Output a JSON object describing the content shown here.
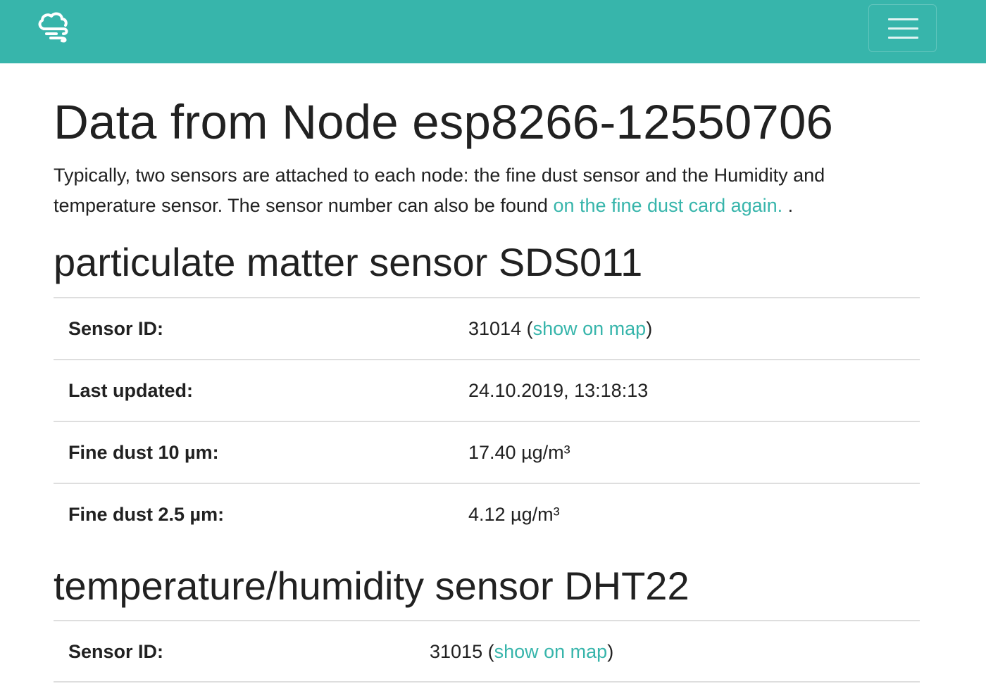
{
  "header": {
    "brand_icon": "cloud-wind-icon",
    "menu_icon": "hamburger-menu-icon",
    "background": "#37b5ab"
  },
  "page": {
    "title": "Data from Node esp8266-12550706",
    "intro_text": "Typically, two sensors are attached to each node: the fine dust sensor and the Humidity and temperature sensor. The sensor number can also be found ",
    "intro_link": "on the fine dust card again.",
    "intro_suffix": " ."
  },
  "sections": [
    {
      "title": "particulate matter sensor SDS011",
      "rows": [
        {
          "label": "Sensor ID:",
          "value": "31014",
          "link": "show on map"
        },
        {
          "label": "Last updated:",
          "value": "24.10.2019, 13:18:13"
        },
        {
          "label": "Fine dust 10 µm:",
          "value": "17.40 µg/m³"
        },
        {
          "label": "Fine dust 2.5 µm:",
          "value": "4.12 µg/m³"
        }
      ]
    },
    {
      "title": "temperature/humidity sensor DHT22",
      "rows": [
        {
          "label": "Sensor ID:",
          "value": "31015",
          "link": "show on map"
        }
      ]
    }
  ],
  "colors": {
    "accent": "#37b5ab",
    "text": "#212121",
    "divider": "#dedede"
  }
}
